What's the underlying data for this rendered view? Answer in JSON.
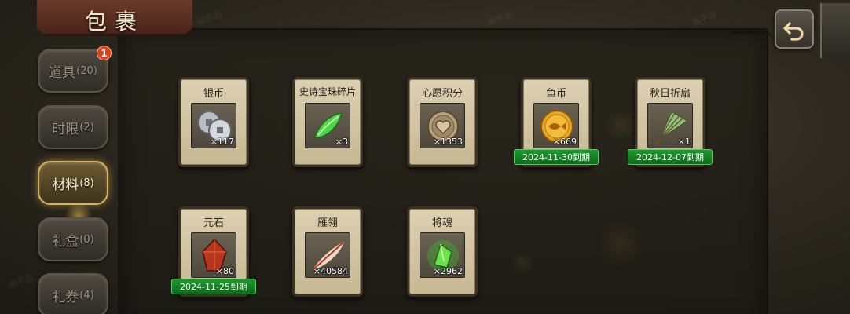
{
  "window": {
    "title": "包裹"
  },
  "tabs": [
    {
      "name": "tab-items",
      "label": "道具",
      "count": "(20)",
      "active": false,
      "badge": "1"
    },
    {
      "name": "tab-timed",
      "label": "时限",
      "count": "(2)",
      "active": false
    },
    {
      "name": "tab-materials",
      "label": "材料",
      "count": "(8)",
      "active": true
    },
    {
      "name": "tab-giftbox",
      "label": "礼盒",
      "count": "(0)",
      "active": false
    },
    {
      "name": "tab-coupons",
      "label": "礼券",
      "count": "(4)",
      "active": false
    }
  ],
  "items": [
    {
      "name": "银币",
      "qty": "×117",
      "icon": "silver-coin-icon",
      "expiry": ""
    },
    {
      "name": "史诗宝珠碎片",
      "qty": "×3",
      "icon": "green-shard-icon",
      "expiry": ""
    },
    {
      "name": "心愿积分",
      "qty": "×1353",
      "icon": "heart-coin-icon",
      "expiry": ""
    },
    {
      "name": "鱼币",
      "qty": "×669",
      "icon": "fish-coin-icon",
      "expiry": "2024-11-30到期"
    },
    {
      "name": "秋日折扇",
      "qty": "×1",
      "icon": "folding-fan-icon",
      "expiry": "2024-12-07到期"
    },
    {
      "name": "元石",
      "qty": "×80",
      "icon": "red-crystal-icon",
      "expiry": "2024-11-25到期"
    },
    {
      "name": "雁翎",
      "qty": "×40584",
      "icon": "feather-icon",
      "expiry": ""
    },
    {
      "name": "将魂",
      "qty": "×2962",
      "icon": "green-soul-icon",
      "expiry": ""
    }
  ],
  "watermark": "闻手游",
  "colors": {
    "expiry_bg": "#1d9a2e",
    "active_tab_border": "#d4b25e",
    "badge": "#d9431e"
  }
}
